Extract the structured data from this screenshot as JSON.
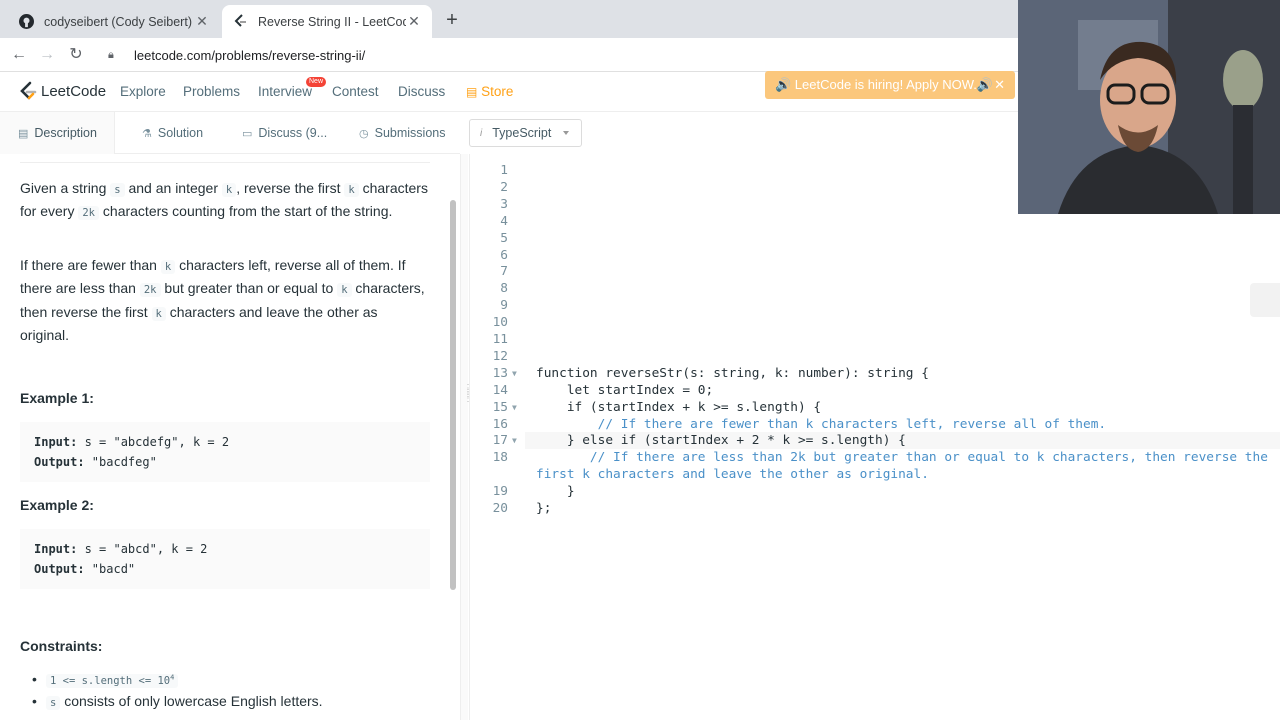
{
  "browser": {
    "tabs": [
      {
        "title": "codyseibert (Cody Seibert)",
        "icon": "github-icon"
      },
      {
        "title": "Reverse String II - LeetCode",
        "icon": "leetcode-icon"
      }
    ],
    "new_tab": "+",
    "url": "leetcode.com/problems/reverse-string-ii/"
  },
  "nav": {
    "logo": "LeetCode",
    "links": [
      "Explore",
      "Problems",
      "Interview",
      "Contest",
      "Discuss",
      "Store"
    ],
    "new_badge": "New",
    "banner": "🔊 LeetCode is hiring! Apply NOW.🔊"
  },
  "panel_tabs": {
    "description": "Description",
    "solution": "Solution",
    "discuss": "Discuss (9...",
    "submissions": "Submissions"
  },
  "language": "TypeScript",
  "description": {
    "p1": [
      "Given a string ",
      "s",
      " and an integer ",
      "k",
      ", reverse the first ",
      "k",
      " characters for every ",
      "2k",
      " characters counting from the start of the string."
    ],
    "p2": [
      "If there are fewer than ",
      "k",
      " characters left, reverse all of them. If there are less than ",
      "2k",
      " but greater than or equal to ",
      "k",
      " characters, then reverse the first ",
      "k",
      " characters and leave the other as original."
    ],
    "example1": {
      "title": "Example 1:",
      "input_label": "Input:",
      "input": " s = \"abcdefg\", k = 2",
      "output_label": "Output:",
      "output": " \"bacdfeg\""
    },
    "example2": {
      "title": "Example 2:",
      "input_label": "Input:",
      "input": " s = \"abcd\", k = 2",
      "output_label": "Output:",
      "output": " \"bacd\""
    },
    "constraints_title": "Constraints:",
    "constraints": [
      {
        "code": "1 <= s.length <= 10",
        "sup": "4"
      },
      {
        "code": "s",
        "text": " consists of only lowercase English letters."
      }
    ]
  },
  "editor": {
    "line_numbers": [
      "1",
      "2",
      "3",
      "4",
      "5",
      "6",
      "7",
      "8",
      "9",
      "10",
      "11",
      "12",
      "13",
      "14",
      "15",
      "16",
      "17",
      "18",
      "",
      "19",
      "20"
    ],
    "code": [
      "",
      "",
      "",
      "",
      "",
      "",
      "",
      "",
      "",
      "",
      "",
      "",
      "function reverseStr(s: string, k: number): string {",
      "    let startIndex = 0;",
      "    if (startIndex + k >= s.length) {",
      "        // If there are fewer than k characters left, reverse all of them.",
      "    } else if (startIndex + 2 * k >= s.length) {",
      "       // If there are less than 2k but greater than or equal to k characters, then reverse the",
      "first k characters and leave the other as original.",
      "    }",
      "};"
    ]
  },
  "colors": {
    "accent": "#ffa116",
    "banner": "#fbc77c"
  }
}
